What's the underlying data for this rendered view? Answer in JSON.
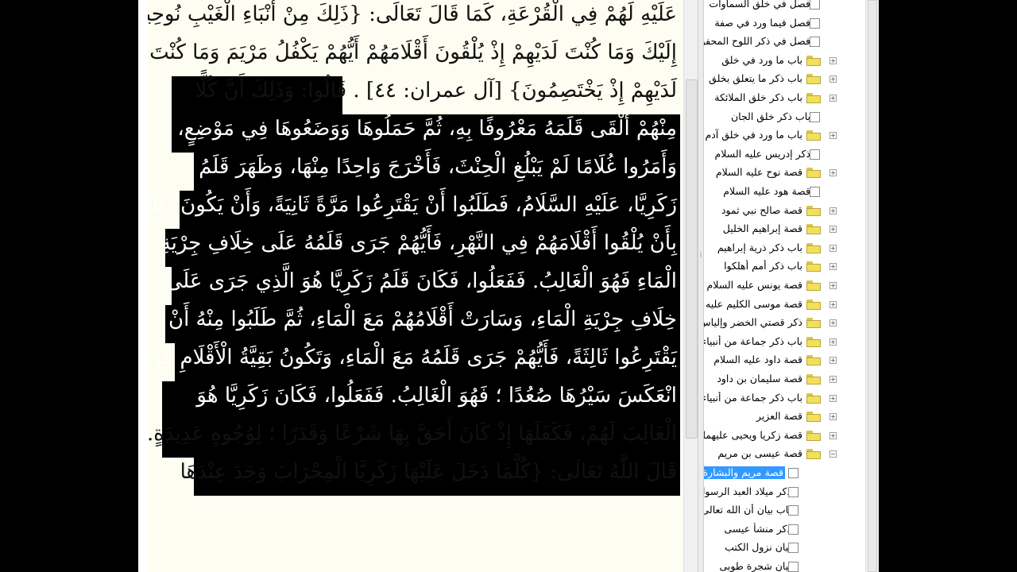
{
  "reader": {
    "lines": [
      "عَلَيْهِ لَهُمْ فِي الْقُرْعَةِ، كَمَا قَالَ تَعَالَى: {ذَلِكَ مِنْ أَنْبَاءِ الْغَيْبِ نُوحِيهِ",
      "إِلَيْكَ وَمَا كُنْتَ لَدَيْهِمْ إِذْ يُلْقُونَ أَقْلَامَهُمْ أَيُّهُمْ يَكْفُلُ مَرْيَمَ وَمَا كُنْتَ",
      "لَدَيْهِمْ إِذْ يَخْتَصِمُونَ} [آل عمران: ٤٤] . قَالُوا: وَذَلِكَ أَنَّ كُلًّا",
      "مِنْهُمْ أَلْقَى قَلَمَهُ مَعْرُوفًا بِهِ، ثُمَّ حَمَلُوهَا وَوَضَعُوهَا فِي مَوْضِعٍ،",
      "وَأَمَرُوا غُلَامًا لَمْ يَبْلُغِ الْحِنْثَ، فَأَخْرَجَ وَاحِدًا مِنْهَا، وَظَهَرَ قَلَمُ",
      "زَكَرِيَّا، عَلَيْهِ السَّلَامُ، فَطَلَبُوا أَنْ يَقْتَرِعُوا مَرَّةً ثَانِيَةً، وَأَنْ يَكُونَ ذَلِكَ",
      "بِأَنْ يُلْقُوا أَقْلَامَهُمْ فِي النَّهْرِ، فَأَيُّهُمْ جَرَى قَلَمُهُ عَلَى خِلَافِ جِرْيَةِ",
      "الْمَاءِ فَهُوَ الْغَالِبُ. فَفَعَلُوا، فَكَانَ قَلَمُ زَكَرِيَّا هُوَ الَّذِي جَرَى عَلَى",
      "خِلَافِ جِرْيَةِ الْمَاءِ، وَسَارَتْ أَقْلَامُهُمْ مَعَ الْمَاءِ، ثُمَّ طَلَبُوا مِنْهُ أَنْ",
      "يَقْتَرِعُوا ثَالِثَةً، فَأَيُّهُمْ جَرَى قَلَمُهُ مَعَ الْمَاءِ، وَتَكُونُ بَقِيَّةُ الْأَقْلَامِ قَدِ",
      "انْعَكَسَ سَيْرُهَا صُعُدًا ؛ فَهُوَ الْغَالِبُ. فَفَعَلُوا، فَكَانَ زَكَرِيَّا هُوَ",
      "الْغَالِبَ لَهُمْ، فَكَفَلَهَا إِذْ كَانَ أَحَقَّ بِهَا شَرْعًا وَقَدَرًا ؛ لِوُجُوهٍ عَدِيدَةٍ.",
      "قَالَ اللَّهُ تَعَالَى: {كُلَّمَا دَخَلَ عَلَيْهَا زَكَرِيَّا الْمِحْرَابَ وَجَدَ عِنْدَهَا"
    ]
  },
  "tree": {
    "items": [
      {
        "label": "فصل في خلق السماوات",
        "folder": false,
        "expand": false,
        "selected": false
      },
      {
        "label": "فصل فيما ورد في صفة",
        "folder": false,
        "expand": false,
        "selected": false
      },
      {
        "label": "فصل في ذكر اللوح المحفوظ",
        "folder": false,
        "expand": false,
        "selected": false
      },
      {
        "label": "باب ما ورد في خلق",
        "folder": true,
        "expand": true,
        "selected": false
      },
      {
        "label": "باب ذكر ما يتعلق بخلق",
        "folder": true,
        "expand": true,
        "selected": false
      },
      {
        "label": "باب ذكر خلق الملائكة",
        "folder": true,
        "expand": true,
        "selected": false
      },
      {
        "label": "باب ذكر خلق الجان",
        "folder": false,
        "expand": false,
        "selected": false
      },
      {
        "label": "باب ما ورد في خلق آدم",
        "folder": true,
        "expand": true,
        "selected": false
      },
      {
        "label": "ذكر إدريس عليه السلام",
        "folder": false,
        "expand": false,
        "selected": false
      },
      {
        "label": "قصة نوح عليه السلام",
        "folder": true,
        "expand": true,
        "selected": false
      },
      {
        "label": "قصة هود عليه السلام",
        "folder": false,
        "expand": false,
        "selected": false
      },
      {
        "label": "قصة صالح نبي ثمود",
        "folder": true,
        "expand": true,
        "selected": false
      },
      {
        "label": "قصة إبراهيم الخليل",
        "folder": true,
        "expand": true,
        "selected": false
      },
      {
        "label": "باب ذكر ذرية إبراهيم",
        "folder": true,
        "expand": true,
        "selected": false
      },
      {
        "label": "باب ذكر أمم أهلكوا",
        "folder": true,
        "expand": true,
        "selected": false
      },
      {
        "label": "قصة يونس عليه السلام",
        "folder": true,
        "expand": true,
        "selected": false
      },
      {
        "label": "قصة موسى الكليم عليه",
        "folder": true,
        "expand": true,
        "selected": false
      },
      {
        "label": "ذكر قصتي الخضر وإلياس",
        "folder": true,
        "expand": true,
        "selected": false
      },
      {
        "label": "باب ذكر جماعة من أنبياء",
        "folder": true,
        "expand": true,
        "selected": false
      },
      {
        "label": "قصة داود عليه السلام",
        "folder": true,
        "expand": true,
        "selected": false
      },
      {
        "label": "قصة سليمان بن داود",
        "folder": true,
        "expand": true,
        "selected": false
      },
      {
        "label": "باب ذكر جماعة من أنبياء",
        "folder": true,
        "expand": true,
        "selected": false
      },
      {
        "label": "قصة العزير",
        "folder": true,
        "expand": true,
        "selected": false
      },
      {
        "label": "قصة زكريا ويحيى عليهما",
        "folder": true,
        "expand": true,
        "selected": false
      },
      {
        "label": "قصة عيسى بن مريم",
        "folder": true,
        "expand": true,
        "open": true,
        "selected": false
      },
      {
        "label": "قصة مريم والبشارة",
        "folder": false,
        "expand": false,
        "selected": true,
        "child": true
      },
      {
        "label": "ذكر ميلاد العبد الرسول",
        "folder": false,
        "expand": false,
        "selected": false,
        "child": true
      },
      {
        "label": "باب بيان أن الله تعالى",
        "folder": false,
        "expand": false,
        "selected": false,
        "child": true
      },
      {
        "label": "ذكر منشأ عيسى",
        "folder": false,
        "expand": false,
        "selected": false,
        "child": true
      },
      {
        "label": "بيان نزول الكتب",
        "folder": false,
        "expand": false,
        "selected": false,
        "child": true
      },
      {
        "label": "بيان شجرة طوبى",
        "folder": false,
        "expand": false,
        "selected": false,
        "child": true
      }
    ]
  }
}
